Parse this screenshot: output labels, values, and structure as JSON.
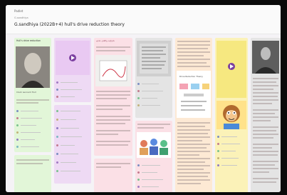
{
  "app": {
    "brand": "Padlet"
  },
  "board": {
    "author": "G.sandhiya",
    "title": "G.sandhiya (2022B+4) hull's drive reduction theory"
  },
  "columns": [
    {
      "header": "Hull's drive reduction",
      "caption": "Clark Leonard Hull"
    },
    {
      "header": "",
      "caption": ""
    },
    {
      "header": "ஹல் மனித கற்றல்",
      "caption": ""
    },
    {
      "header": "",
      "caption": ""
    },
    {
      "header": "",
      "caption": "Drive Reduction Theory"
    },
    {
      "header": "",
      "caption": ""
    },
    {
      "header": "",
      "caption": ""
    }
  ],
  "colors": {
    "green": "#e2f6d8",
    "purple": "#eedaf4",
    "pink": "#fbe0e6",
    "yellow": "#fbf2b8",
    "peach": "#fde9d4",
    "grey": "#e4e4e4"
  }
}
